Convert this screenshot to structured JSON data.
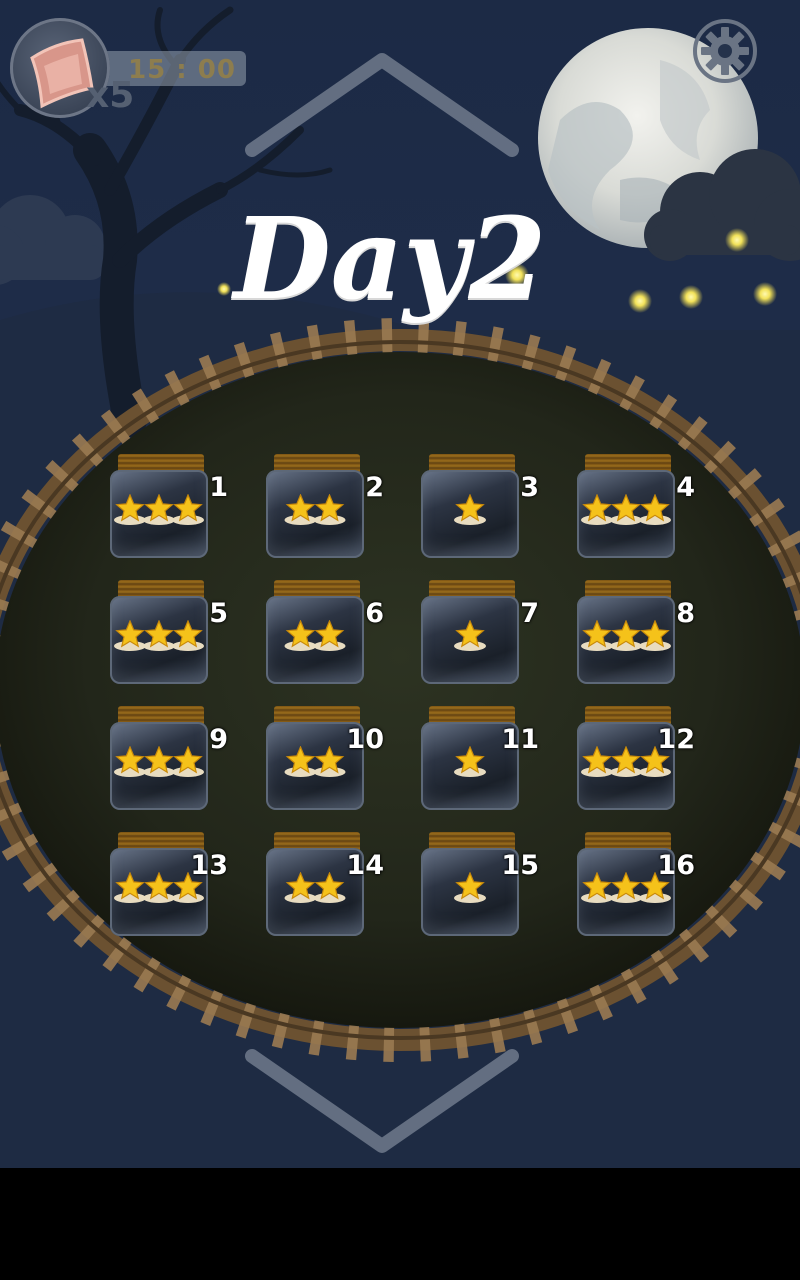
{
  "hud": {
    "pillow_count": "x5",
    "timer": "15 : 00",
    "pillow_icon": "pillow-icon",
    "settings_icon": "gear-icon"
  },
  "title": "Day2",
  "navigation": {
    "up_icon": "chevron-up-icon",
    "down_icon": "chevron-down-icon"
  },
  "levels": [
    {
      "number": "1",
      "stars": 3
    },
    {
      "number": "2",
      "stars": 2
    },
    {
      "number": "3",
      "stars": 1
    },
    {
      "number": "4",
      "stars": 3
    },
    {
      "number": "5",
      "stars": 3
    },
    {
      "number": "6",
      "stars": 2
    },
    {
      "number": "7",
      "stars": 1
    },
    {
      "number": "8",
      "stars": 3
    },
    {
      "number": "9",
      "stars": 3
    },
    {
      "number": "10",
      "stars": 2
    },
    {
      "number": "11",
      "stars": 1
    },
    {
      "number": "12",
      "stars": 3
    },
    {
      "number": "13",
      "stars": 3
    },
    {
      "number": "14",
      "stars": 2
    },
    {
      "number": "15",
      "stars": 1
    },
    {
      "number": "16",
      "stars": 3
    }
  ],
  "colors": {
    "sky": "#1f2d4a",
    "field": "#262a1c",
    "star": "#f5c21a",
    "fence": "#8a6a42"
  }
}
